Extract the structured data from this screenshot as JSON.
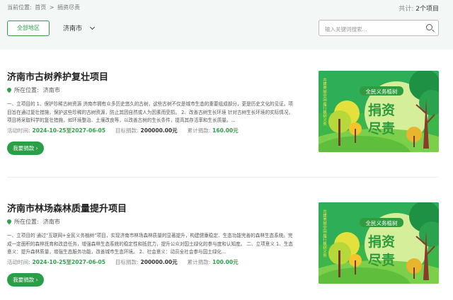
{
  "breadcrumb": {
    "prefix": "当前位置:",
    "home": "首页",
    "sep": ">",
    "current": "捐资尽责"
  },
  "total": {
    "label": "共计:",
    "count": "2个项目"
  },
  "filter": {
    "region_label": "全部地区",
    "city": "济南市"
  },
  "search": {
    "placeholder": "输入关键词搜索..."
  },
  "projects": [
    {
      "title": "济南市古树养护复壮项目",
      "location_label": "所在位置:",
      "location": "济南市",
      "description": "一、立项目的 1、保护珍稀古树资源 济南市拥有众多历史悠久的古树，这些古树不仅是城市生态的重要组成部分，更是历史文化的见证。项目旨在通过复壮措施，保护这些珍稀的古树资源，防止其因自然或人为因素而受损。 2、改善古树生长环境 针对古树生长环境的实际情况，项目将采取科学的复壮措施，如环境整治、土壤改良等，以改善古树的生长条件，提高其存活率和生长质量。...",
      "period_label": "活动时间:",
      "period": "2024-10-25至2027-06-05",
      "goal_label": "目标捐款:",
      "goal": "200000.00元",
      "raised_label": "累计捐款:",
      "raised": "160.00元",
      "donate_label": "我要捐款 ›"
    },
    {
      "title": "济南市林场森林质量提升项目",
      "location_label": "所在位置:",
      "location": "济南市",
      "description": "一、立项目的 通过“互联网+全民义务植树”项目，实现济南市林场森林质量的显著提升，构建健康稳定、生态功能完善的森林生态系统。完成一定面积的森林抚育和改造任务，增强森林生态系统的稳定性和抵抗力，提升公众对国土绿化的参与度和认知度。 二、立项意义 1、生态意义：提升森林质量，增强生态服务功能，改善城市生态环境。 2、社会意义：动员全社会参与国土绿化...",
      "period_label": "活动时间:",
      "period": "2024-10-25至2027-06-05",
      "goal_label": "目标捐款:",
      "goal": "200000.00元",
      "raised_label": "累计捐款:",
      "raised": "100.00元",
      "donate_label": "我要捐款 ›"
    }
  ],
  "banner": {
    "side_text": "共建美丽中国 履行植树义务",
    "tag": "全民义务植树",
    "line1": "捐资",
    "line2": "尽责"
  }
}
